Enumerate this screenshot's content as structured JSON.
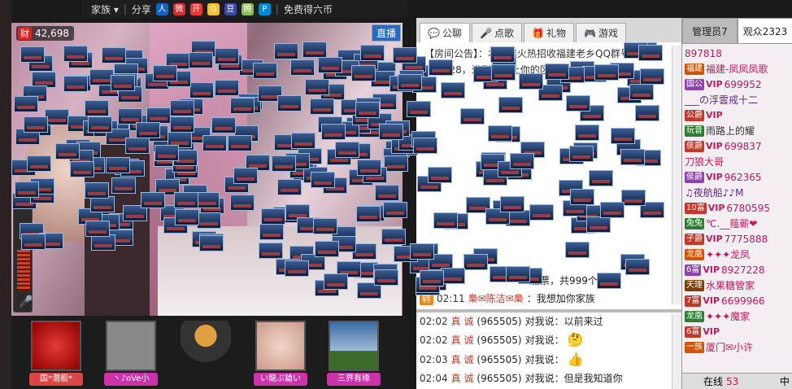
{
  "toolbar": {
    "family_label": "家族",
    "share_label": "分享",
    "free_coins_label": "免费得六币"
  },
  "video": {
    "cash_icon": "财",
    "cash_value": "42,698",
    "live_badge": "直播"
  },
  "gifts": [
    {
      "label": "国*潜艇*",
      "color": "#d44"
    },
    {
      "label": "丶♪oVe小",
      "color": "#c3a"
    },
    {
      "label": "",
      "color": ""
    },
    {
      "label": "い龍ぶ鎗い",
      "color": "#c3a"
    },
    {
      "label": "三界有缘",
      "color": "#c3a"
    }
  ],
  "chat": {
    "tabs": [
      {
        "label": "公聊",
        "icon": "chat-icon"
      },
      {
        "label": "点歌",
        "icon": "mic-icon"
      },
      {
        "label": "礼物",
        "icon": "gift-icon"
      },
      {
        "label": "游戏",
        "icon": "game-icon"
      }
    ],
    "notice_line1": "【房间公告】：本家族火热招收福建老乡QQ群号9",
    "notice_line2": "435528，进群者带上你的区号 ...243050",
    "ticket_text": "船票，共999个",
    "public_line": {
      "badge": "转",
      "time": "02:11",
      "who": "梟✉陈洁✉梟",
      "text": "：我想加你家族"
    },
    "private_lines": [
      {
        "time": "02:02",
        "who": "真 诚",
        "id": "(965505)",
        "text": "对我说：以前来过"
      },
      {
        "time": "02:02",
        "who": "真 诚",
        "id": "(965505)",
        "text": "对我说：",
        "emoji": "🤔"
      },
      {
        "time": "02:03",
        "who": "真 诚",
        "id": "(965505)",
        "text": "对我说：",
        "emoji": "👍"
      },
      {
        "time": "02:04",
        "who": "真 诚",
        "id": "(965505)",
        "text": "对我说：但是我知道你"
      }
    ]
  },
  "right": {
    "tab_admin": "管理员7",
    "tab_viewers": "观众2323",
    "users": [
      {
        "tag": "",
        "name": "897818",
        "color": "#c2185b"
      },
      {
        "tag": "福建",
        "name": "福建-凤凤凤歌",
        "color": "#c2185b"
      },
      {
        "tag": "国公",
        "vip": "VIP",
        "name": "699952",
        "color": "#c2185b"
      },
      {
        "tag": "",
        "name": "___の浮雲戒十二",
        "color": "#5a2a86"
      },
      {
        "tag": "公爵",
        "vip": "VIP",
        "name": "",
        "color": "#c2185b"
      },
      {
        "tag": "玩音",
        "name": "雨路上的耀",
        "color": "#333"
      },
      {
        "tag": "侯爵",
        "vip": "VIP",
        "name": "699837",
        "color": "#c2185b"
      },
      {
        "tag": "",
        "name": "刀狼大哥",
        "color": "#c2185b"
      },
      {
        "tag": "侯爵",
        "vip": "VIP",
        "name": "962365",
        "color": "#c2185b"
      },
      {
        "tag": "",
        "name": "♫夜航船♪♪M",
        "color": "#5a2a86"
      },
      {
        "tag": "10富",
        "vip": "VIP",
        "name": "6780595",
        "color": "#c2185b"
      },
      {
        "tag": "兔兔",
        "name": "℃.__薤蕲❤",
        "color": "#c2185b"
      },
      {
        "tag": "子爵",
        "vip": "VIP",
        "name": "7775888",
        "color": "#c2185b"
      },
      {
        "tag": "龙凰",
        "name": "✦✦✦龙凤",
        "color": "#c2185b"
      },
      {
        "tag": "6富",
        "vip": "VIP",
        "name": "8927228",
        "color": "#c2185b"
      },
      {
        "tag": "天理",
        "name": "水果糖管家",
        "color": "#c2185b"
      },
      {
        "tag": "7富",
        "vip": "VIP",
        "name": "6699966",
        "color": "#c2185b"
      },
      {
        "tag": "龙凰",
        "name": "✦✦✦魔家",
        "color": "#c2185b"
      },
      {
        "tag": "6富",
        "vip": "VIP",
        "name": "",
        "color": "#c2185b"
      },
      {
        "tag": "一族",
        "name": "厦门✉小许",
        "color": "#c2185b"
      }
    ],
    "online_label": "在线",
    "online_count": "53",
    "bottom_right": "中"
  }
}
